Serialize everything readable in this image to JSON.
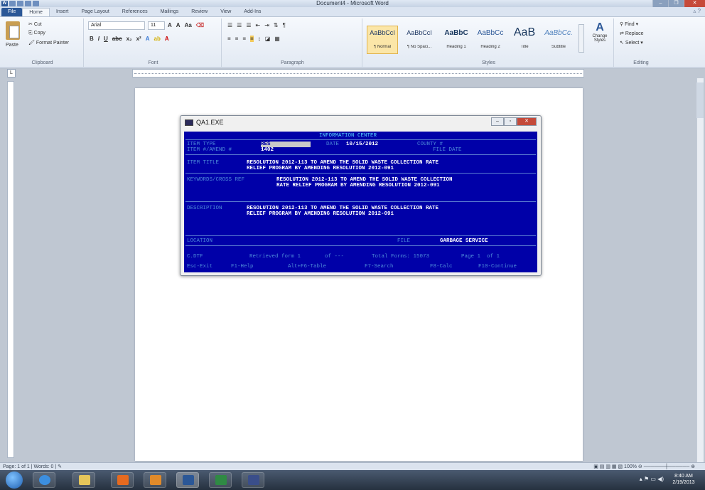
{
  "window": {
    "title": "Document4 - Microsoft Word"
  },
  "tabs": [
    "File",
    "Home",
    "Insert",
    "Page Layout",
    "References",
    "Mailings",
    "Review",
    "View",
    "Add-Ins"
  ],
  "clipboard": {
    "paste": "Paste",
    "cut": "Cut",
    "copy": "Copy",
    "format_painter": "Format Painter",
    "label": "Clipboard"
  },
  "font": {
    "name": "Arial",
    "size": "11",
    "label": "Font"
  },
  "paragraph": {
    "label": "Paragraph"
  },
  "styles": {
    "label": "Styles",
    "items": [
      {
        "sample": "AaBbCcI",
        "name": "¶ Normal"
      },
      {
        "sample": "AaBbCcI",
        "name": "¶ No Spaci..."
      },
      {
        "sample": "AaBbC",
        "name": "Heading 1"
      },
      {
        "sample": "AaBbCc",
        "name": "Heading 2"
      },
      {
        "sample": "AaB",
        "name": "Title"
      },
      {
        "sample": "AaBbCc.",
        "name": "Subtitle"
      }
    ],
    "change": "Change Styles"
  },
  "editing": {
    "find": "Find",
    "replace": "Replace",
    "select": "Select",
    "label": "Editing"
  },
  "dos": {
    "title": "QA1.EXE",
    "header": "INFORMATION CENTER",
    "item_type_label": "ITEM TYPE",
    "item_type_value": "RES",
    "date_label": "DATE",
    "date_value": "10/15/2012",
    "county_label": "COUNTY #",
    "item_no_label": "ITEM #/AMEND #",
    "item_no_value": "1402",
    "file_date_label": "FILE DATE",
    "item_title_label": "ITEM TITLE",
    "item_title_1": "RESOLUTION 2012-113 TO AMEND THE SOLID WASTE COLLECTION RATE",
    "item_title_2": "RELIEF PROGRAM BY AMENDING RESOLUTION 2012-091",
    "keywords_label": "KEYWORDS/CROSS REF",
    "keywords_1": "RESOLUTION 2012-113 TO AMEND THE SOLID WASTE COLLECTION",
    "keywords_2": "RATE RELIEF PROGRAM BY AMENDING RESOLUTION 2012-091",
    "description_label": "DESCRIPTION",
    "description_1": "RESOLUTION 2012-113 TO AMEND THE SOLID WASTE COLLECTION RATE",
    "description_2": "RELIEF PROGRAM BY AMENDING RESOLUTION 2012-091",
    "location_label": "LOCATION",
    "file_label": "FILE",
    "file_value": "GARBAGE SERVICE",
    "status_file": "C.DTF",
    "status_retrieved": "Retrieved form 1",
    "status_of": "of ---",
    "status_total": "Total Forms: 15073",
    "status_page": "Page 1  of 1",
    "keys": [
      "Esc-Exit",
      "F1-Help",
      "Alt+F6-Table",
      "F7-Search",
      "F8-Calc",
      "F10-Continue"
    ]
  },
  "status": {
    "page": "Page: 1 of 1",
    "words": "Words: 0",
    "zoom": "100%"
  },
  "taskbar": {
    "time": "8:40 AM",
    "date": "2/19/2013"
  }
}
